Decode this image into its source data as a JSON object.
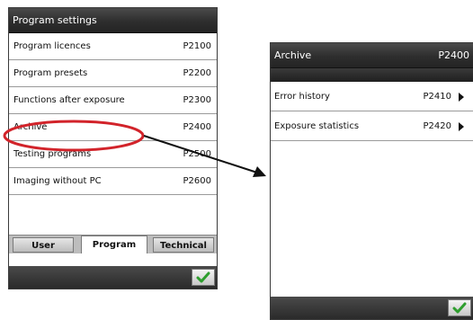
{
  "left_panel": {
    "title": "Program settings",
    "items": [
      {
        "label": "Program licences",
        "code": "P2100"
      },
      {
        "label": "Program presets",
        "code": "P2200"
      },
      {
        "label": "Functions after exposure",
        "code": "P2300"
      },
      {
        "label": "Archive",
        "code": "P2400"
      },
      {
        "label": "Testing programs",
        "code": "P2500"
      },
      {
        "label": "Imaging without PC",
        "code": "P2600"
      }
    ],
    "tabs": [
      "User",
      "Program",
      "Technical"
    ],
    "active_tab": "Program"
  },
  "right_panel": {
    "title": "Archive",
    "title_code": "P2400",
    "items": [
      {
        "label": "Error history",
        "code": "P2410"
      },
      {
        "label": "Exposure statistics",
        "code": "P2420"
      }
    ]
  },
  "icons": {
    "submenu": "arrow-right-icon",
    "confirm": "check-icon"
  },
  "colors": {
    "callout": "#d2232a",
    "check": "#2e9e2e",
    "titlebar": "#2e2e2e"
  }
}
